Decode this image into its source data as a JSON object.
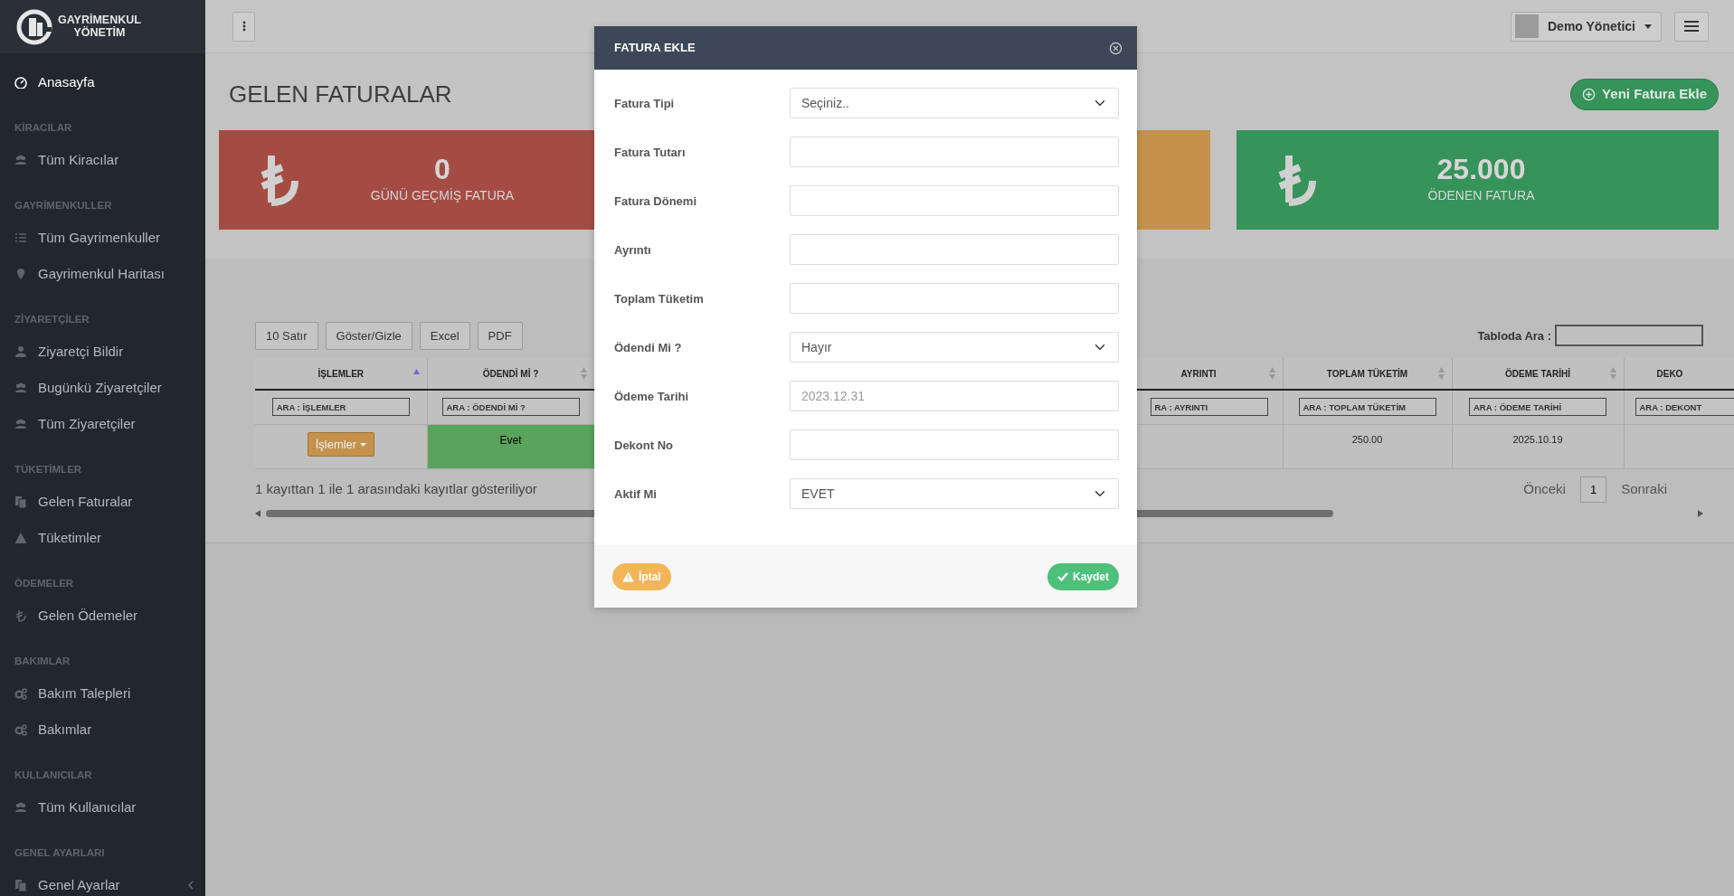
{
  "sidebar": {
    "logo": {
      "line1": "GAYRİMENKUL",
      "line2": "YÖNETİM"
    },
    "items": [
      {
        "kind": "link",
        "label": "Anasayfa",
        "selected": true
      },
      {
        "kind": "heading",
        "label": "KİRACILAR"
      },
      {
        "kind": "link",
        "label": "Tüm Kiracılar",
        "selected": false
      },
      {
        "kind": "heading",
        "label": "GAYRİMENKULLER"
      },
      {
        "kind": "link",
        "label": "Tüm Gayrimenkuller",
        "selected": false
      },
      {
        "kind": "link",
        "label": "Gayrimenkul Haritası",
        "selected": false
      },
      {
        "kind": "heading",
        "label": "ZİYARETÇİLER"
      },
      {
        "kind": "link",
        "label": "Ziyaretçi Bildir",
        "selected": false
      },
      {
        "kind": "link",
        "label": "Bugünkü Ziyaretçiler",
        "selected": false
      },
      {
        "kind": "link",
        "label": "Tüm Ziyaretçiler",
        "selected": false
      },
      {
        "kind": "heading",
        "label": "TÜKETİMLER"
      },
      {
        "kind": "link",
        "label": "Gelen Faturalar",
        "selected": false
      },
      {
        "kind": "link",
        "label": "Tüketimler",
        "selected": false
      },
      {
        "kind": "heading",
        "label": "ÖDEMELER"
      },
      {
        "kind": "link",
        "label": "Gelen Ödemeler",
        "selected": false
      },
      {
        "kind": "heading",
        "label": "BAKIMLAR"
      },
      {
        "kind": "link",
        "label": "Bakım Talepleri",
        "selected": false
      },
      {
        "kind": "link",
        "label": "Bakımlar",
        "selected": false
      },
      {
        "kind": "heading",
        "label": "KULLANICILAR"
      },
      {
        "kind": "link",
        "label": "Tüm Kullanıcılar",
        "selected": false
      },
      {
        "kind": "heading",
        "label": "GENEL AYARLARI"
      },
      {
        "kind": "link",
        "label": "Genel Ayarlar",
        "selected": false,
        "has_submenu": true
      }
    ]
  },
  "topbar": {
    "user": "Demo Yönetici"
  },
  "page": {
    "title": "GELEN FATURALAR",
    "new_button": "Yeni Fatura Ekle"
  },
  "stat_cards": [
    {
      "color": "#a44c44",
      "value": "0",
      "label": "GÜNÜ GEÇMİŞ FATURA"
    },
    {
      "color": "#c4924d"
    },
    {
      "color": "#36935a",
      "value": "25.000",
      "label": "ÖDENEN FATURA"
    }
  ],
  "table": {
    "buttons": [
      "10 Satır",
      "Göster/Gizle",
      "Excel",
      "PDF"
    ],
    "search_label": "Tabloda Ara :",
    "columns": [
      {
        "label": "İŞLEMLER",
        "sorted": true,
        "placeholder": "ARA : İŞLEMLER"
      },
      {
        "label": "ÖDENDİ Mİ ?",
        "sorted": false,
        "placeholder": "ARA : ÖDENDİ Mİ ?"
      },
      {
        "label": "AYRINTI",
        "sorted": false,
        "placeholder": "RA : AYRINTI"
      },
      {
        "label": "TOPLAM TÜKETİM",
        "sorted": false,
        "placeholder": "ARA : TOPLAM TÜKETİM"
      },
      {
        "label": "ÖDEME TARİHİ",
        "sorted": false,
        "placeholder": "ARA : ÖDEME TARİHİ"
      },
      {
        "label": "DEKO",
        "placeholder": "ARA : DEKONT"
      }
    ],
    "rows": [
      {
        "action": "İşlemler",
        "paid_label": "Evet",
        "paid": true,
        "total": "250.00",
        "payment_date": "2025.10.19"
      }
    ],
    "info": "1 kayıttan 1 ile 1 arasındaki kayıtlar gösteriliyor",
    "pagination": {
      "prev": "Önceki",
      "pages": [
        {
          "label": "1",
          "selected": true
        }
      ],
      "next": "Sonraki"
    }
  },
  "modal": {
    "title": "FATURA EKLE",
    "fields": [
      {
        "label": "Fatura Tipi",
        "kind": "select",
        "value": "Seçiniz.."
      },
      {
        "label": "Fatura Tutarı",
        "kind": "input"
      },
      {
        "label": "Fatura Dönemi",
        "kind": "input"
      },
      {
        "label": "Ayrıntı",
        "kind": "input"
      },
      {
        "label": "Toplam Tüketim",
        "kind": "input"
      },
      {
        "label": "Ödendi Mi ?",
        "kind": "select",
        "value": "Hayır"
      },
      {
        "label": "Ödeme Tarihi",
        "kind": "input",
        "placeholder": "2023.12.31"
      },
      {
        "label": "Dekont No",
        "kind": "input"
      },
      {
        "label": "Aktif Mi",
        "kind": "select",
        "value": "EVET"
      }
    ],
    "cancel": "İptal",
    "save": "Kaydet"
  }
}
